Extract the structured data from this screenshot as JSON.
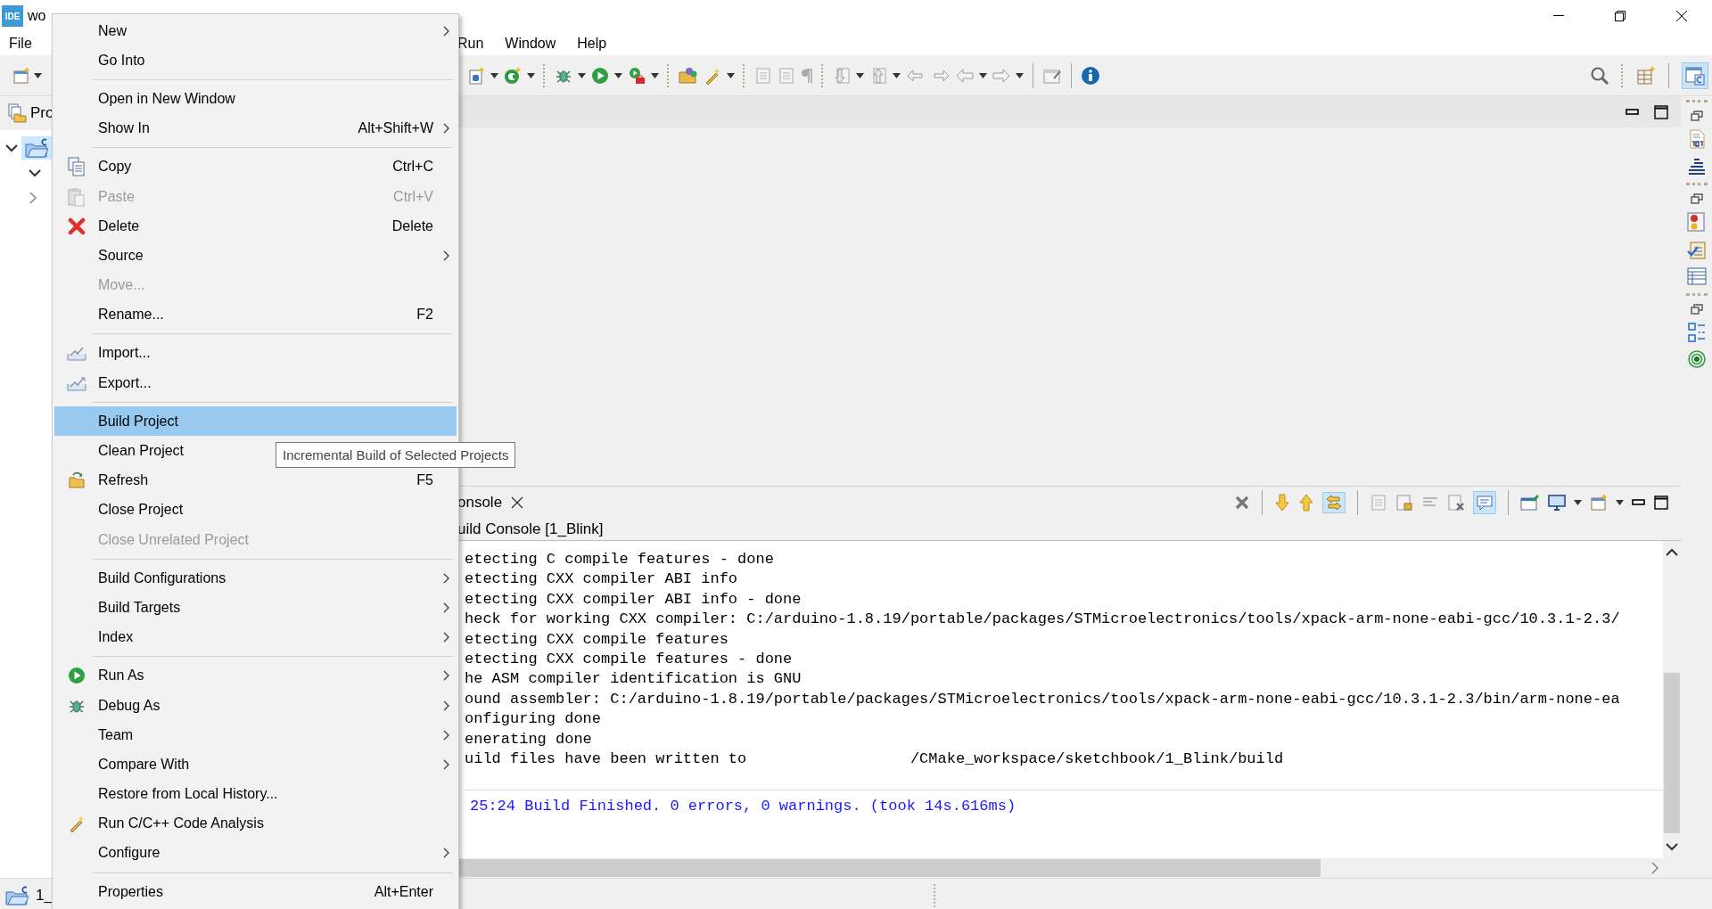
{
  "window": {
    "logo": "IDE",
    "title": "wo"
  },
  "menu_bar": {
    "visible_left": [
      "File"
    ],
    "visible_right": [
      "Run",
      "Window",
      "Help"
    ]
  },
  "perspective_button": {
    "selected": true
  },
  "explorer": {
    "tab": "Pro",
    "tree": [
      {
        "expanded": true,
        "selected": true,
        "children": [
          {
            "expanded": true
          },
          {
            "expanded": false
          }
        ]
      }
    ]
  },
  "context_menu": {
    "items": [
      {
        "kind": "item",
        "label": "New",
        "submenu": true,
        "disabled": false,
        "selected": false
      },
      {
        "kind": "item",
        "label": "Go Into",
        "submenu": false,
        "disabled": false,
        "selected": false
      },
      {
        "kind": "separator"
      },
      {
        "kind": "item",
        "label": "Open in New Window",
        "submenu": false,
        "disabled": false,
        "selected": false
      },
      {
        "kind": "item",
        "label": "Show In",
        "shortcut": "Alt+Shift+W",
        "submenu": true,
        "disabled": false,
        "selected": false
      },
      {
        "kind": "separator"
      },
      {
        "kind": "copy",
        "label": "Copy",
        "shortcut": "Ctrl+C",
        "submenu": false,
        "disabled": false,
        "selected": false
      },
      {
        "kind": "paste",
        "label": "Paste",
        "shortcut": "Ctrl+V",
        "submenu": false,
        "disabled": true,
        "selected": false
      },
      {
        "kind": "delete",
        "label": "Delete",
        "shortcut": "Delete",
        "submenu": false,
        "disabled": false,
        "selected": false
      },
      {
        "kind": "item",
        "label": "Source",
        "submenu": true,
        "disabled": false,
        "selected": false
      },
      {
        "kind": "item",
        "label": "Move...",
        "submenu": false,
        "disabled": true,
        "selected": false
      },
      {
        "kind": "item",
        "label": "Rename...",
        "shortcut": "F2",
        "submenu": false,
        "disabled": false,
        "selected": false
      },
      {
        "kind": "separator"
      },
      {
        "kind": "import",
        "label": "Import...",
        "submenu": false,
        "disabled": false,
        "selected": false
      },
      {
        "kind": "export",
        "label": "Export...",
        "submenu": false,
        "disabled": false,
        "selected": false
      },
      {
        "kind": "separator"
      },
      {
        "kind": "item",
        "label": "Build Project",
        "submenu": false,
        "disabled": false,
        "selected": true
      },
      {
        "kind": "item",
        "label": "Clean Project",
        "submenu": false,
        "disabled": false,
        "selected": false
      },
      {
        "kind": "refresh",
        "label": "Refresh",
        "shortcut": "F5",
        "submenu": false,
        "disabled": false,
        "selected": false
      },
      {
        "kind": "item",
        "label": "Close Project",
        "submenu": false,
        "disabled": false,
        "selected": false
      },
      {
        "kind": "item",
        "label": "Close Unrelated Project",
        "submenu": false,
        "disabled": true,
        "selected": false
      },
      {
        "kind": "separator"
      },
      {
        "kind": "item",
        "label": "Build Configurations",
        "submenu": true,
        "disabled": false,
        "selected": false
      },
      {
        "kind": "item",
        "label": "Build Targets",
        "submenu": true,
        "disabled": false,
        "selected": false
      },
      {
        "kind": "item",
        "label": "Index",
        "submenu": true,
        "disabled": false,
        "selected": false
      },
      {
        "kind": "separator"
      },
      {
        "kind": "run",
        "label": "Run As",
        "submenu": true,
        "disabled": false,
        "selected": false
      },
      {
        "kind": "debug",
        "label": "Debug As",
        "submenu": true,
        "disabled": false,
        "selected": false
      },
      {
        "kind": "item",
        "label": "Team",
        "submenu": true,
        "disabled": false,
        "selected": false
      },
      {
        "kind": "item",
        "label": "Compare With",
        "submenu": true,
        "disabled": false,
        "selected": false
      },
      {
        "kind": "item",
        "label": "Restore from Local History...",
        "submenu": false,
        "disabled": false,
        "selected": false
      },
      {
        "kind": "analysis",
        "label": "Run C/C++ Code Analysis",
        "submenu": false,
        "disabled": false,
        "selected": false
      },
      {
        "kind": "item",
        "label": "Configure",
        "submenu": true,
        "disabled": false,
        "selected": false
      },
      {
        "kind": "separator"
      },
      {
        "kind": "item",
        "label": "Properties",
        "shortcut": "Alt+Enter",
        "submenu": false,
        "disabled": false,
        "selected": false
      }
    ]
  },
  "tooltip": {
    "text": "Incremental Build of Selected Projects"
  },
  "console": {
    "tab": "onsole",
    "subtitle": "uild Console [1_Blink]",
    "toggles": [
      {
        "on": true
      },
      {
        "on": true
      }
    ],
    "lines": [
      {
        "kind": "output",
        "text": "etecting C compile features - done"
      },
      {
        "kind": "output",
        "text": "etecting CXX compiler ABI info"
      },
      {
        "kind": "output",
        "text": "etecting CXX compiler ABI info - done"
      },
      {
        "kind": "output",
        "text": "heck for working CXX compiler: C:/arduino-1.8.19/portable/packages/STMicroelectronics/tools/xpack-arm-none-eabi-gcc/10.3.1-2.3/"
      },
      {
        "kind": "output",
        "text": "etecting CXX compile features"
      },
      {
        "kind": "output",
        "text": "etecting CXX compile features - done"
      },
      {
        "kind": "output",
        "text": "he ASM compiler identification is GNU"
      },
      {
        "kind": "output",
        "text": "ound assembler: C:/arduino-1.8.19/portable/packages/STMicroelectronics/tools/xpack-arm-none-eabi-gcc/10.3.1-2.3/bin/arm-none-ea"
      },
      {
        "kind": "output",
        "text": "onfiguring done"
      },
      {
        "kind": "output",
        "text": "enerating done"
      },
      {
        "kind": "output",
        "text": "uild files have been written to                  /CMake_workspace/sketchbook/1_Blink/build"
      },
      {
        "kind": "status",
        "text": "25:24 Build Finished. 0 errors, 0 warnings. (took 14s.616ms)"
      }
    ]
  },
  "status_bar": {
    "project": "1_"
  }
}
